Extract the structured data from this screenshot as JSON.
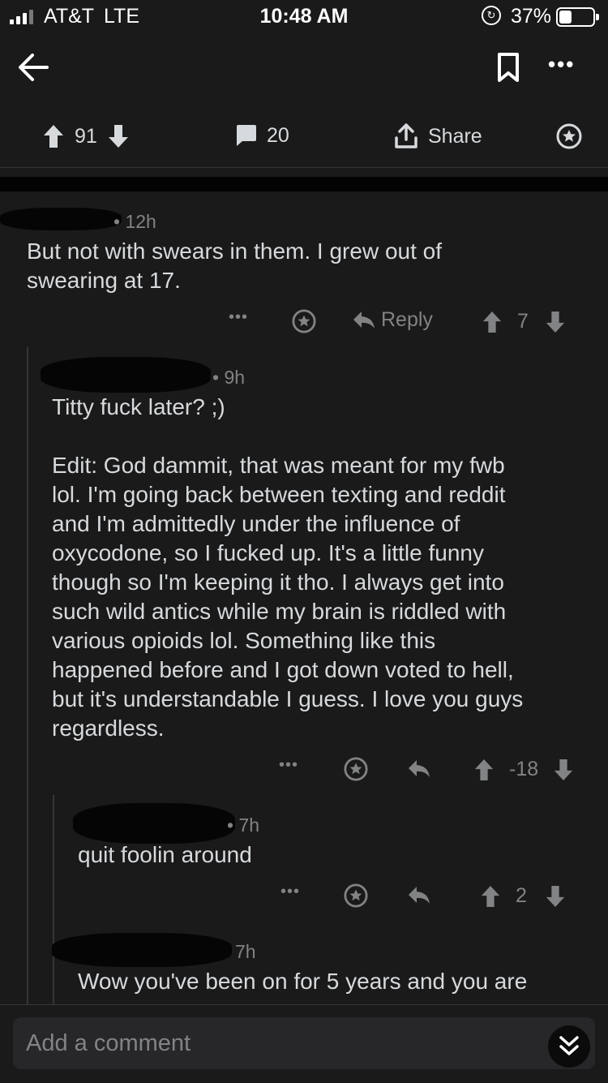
{
  "status_bar": {
    "carrier": "AT&T",
    "network": "LTE",
    "time": "10:48 AM",
    "battery_percent": "37%",
    "battery_level": 0.37
  },
  "post_actions": {
    "upvotes": "91",
    "comments": "20",
    "share_label": "Share"
  },
  "comments": [
    {
      "age": "• 12h",
      "body": "But not with swears in them. I grew out of\nswearing at 17.",
      "reply_label": "Reply",
      "score": "7"
    },
    {
      "age": "• 9h",
      "body": "Titty fuck later? ;)\n\nEdit: God dammit, that was meant for my fwb\nlol. I'm going back between texting and reddit\nand I'm admittedly under the influence of\noxycodone, so I fucked up. It's a little funny\nthough so I'm keeping it tho. I always get into\nsuch wild antics while my brain is riddled with\nvarious opioids lol. Something like this\nhappened before and I got down voted to hell,\nbut it's understandable I guess. I love you guys\nregardless.",
      "score": "-18"
    },
    {
      "age": "• 7h",
      "body": "quit foolin around",
      "score": "2"
    },
    {
      "age": "7h",
      "body": "Wow you've been on for 5 years and you are"
    }
  ],
  "comment_bar": {
    "placeholder": "Add a comment"
  },
  "colors": {
    "background": "#1a1a1b",
    "text": "#d7dadc",
    "muted": "#818384"
  }
}
